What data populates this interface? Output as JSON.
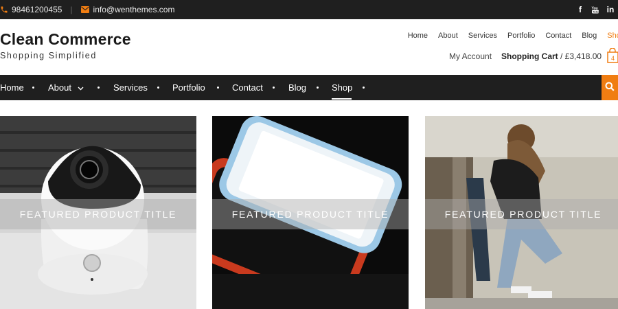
{
  "topbar": {
    "phone": "98461200455",
    "separator": "|",
    "email": "info@wenthemes.com",
    "social_icons": [
      "facebook-icon",
      "youtube-icon",
      "linkedin-icon"
    ]
  },
  "header": {
    "site_title": "Clean Commerce",
    "tagline": "Shopping Simplified",
    "menu": [
      "Home",
      "About",
      "Services",
      "Portfolio",
      "Contact",
      "Blog",
      "Shop"
    ],
    "account_label": "My Account",
    "cart_label": "Shopping Cart",
    "cart_amount": " / £3,418.00",
    "cart_count": "4"
  },
  "nav": {
    "items": [
      "Home",
      "About",
      "Services",
      "Portfolio",
      "Contact",
      "Blog",
      "Shop"
    ],
    "active": "Shop"
  },
  "products": [
    {
      "title": "FEATURED PRODUCT TITLE"
    },
    {
      "title": "FEATURED PRODUCT TITLE"
    },
    {
      "title": "FEATURED PRODUCT TITLE"
    }
  ],
  "colors": {
    "accent": "#f07d12",
    "bar": "#1f1f1f"
  }
}
